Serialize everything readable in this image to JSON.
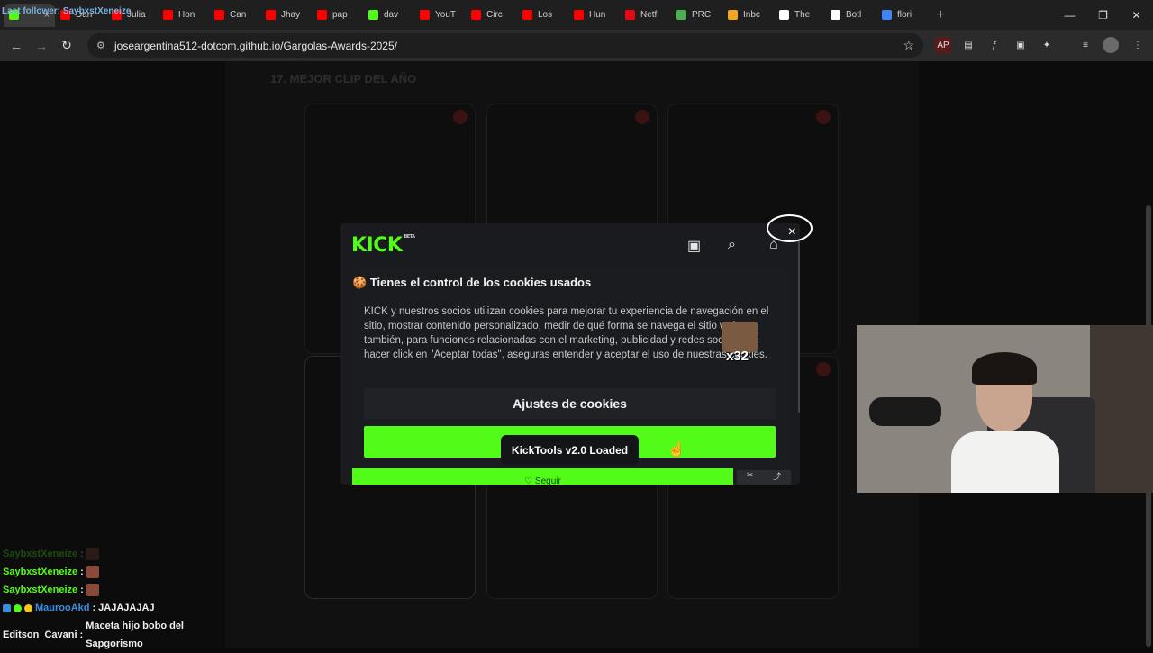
{
  "stream_overlay": {
    "follower_text": "Last follower: SaybxstXeneize"
  },
  "browser": {
    "tabs": [
      {
        "label": "",
        "favicon_color": "#53fc18",
        "active": true
      },
      {
        "label": "Dan",
        "favicon_color": "#ff0000"
      },
      {
        "label": "Julia",
        "favicon_color": "#ff0000"
      },
      {
        "label": "Hon",
        "favicon_color": "#ff0000"
      },
      {
        "label": "Can",
        "favicon_color": "#ff0000"
      },
      {
        "label": "Jhay",
        "favicon_color": "#ff0000"
      },
      {
        "label": "pap",
        "favicon_color": "#ff0000"
      },
      {
        "label": "dav",
        "favicon_color": "#53fc18"
      },
      {
        "label": "YouT",
        "favicon_color": "#ff0000"
      },
      {
        "label": "Circ",
        "favicon_color": "#ff0000"
      },
      {
        "label": "Los",
        "favicon_color": "#ff0000"
      },
      {
        "label": "Hun",
        "favicon_color": "#ff0000"
      },
      {
        "label": "Netf",
        "favicon_color": "#e50914"
      },
      {
        "label": "PRC",
        "favicon_color": "#4caf50"
      },
      {
        "label": "Inbc",
        "favicon_color": "#f5a623"
      },
      {
        "label": "The",
        "favicon_color": "#ffffff"
      },
      {
        "label": "Botl",
        "favicon_color": "#ffffff"
      },
      {
        "label": "flori",
        "favicon_color": "#4285f4"
      }
    ],
    "url": "joseargentina512-dotcom.github.io/Gargolas-Awards-2025/"
  },
  "page": {
    "section_title": "17. MEJOR CLIP DEL AÑO"
  },
  "kick_modal": {
    "logo": "KICK",
    "logo_badge": "BETA",
    "cookie_title": "Tienes el control de los cookies usados",
    "cookie_text": "KICK y nuestros socios utilizan cookies para mejorar tu experiencia de navegación en el sitio, mostrar contenido personalizado, medir de qué forma se navega el sitio web y, también, para funciones relacionadas con el marketing, publicidad y redes sociales. Al hacer click en \"Aceptar todas\", aseguras entender y aceptar el uso de nuestras cookies.",
    "settings_button": "Ajustes de cookies",
    "follow_button": "♡ Seguir",
    "close": "×"
  },
  "toast": {
    "text": "KickTools v2.0 Loaded"
  },
  "emote_overlay": {
    "multiplier": "x32"
  },
  "chat": {
    "messages": [
      {
        "user": "SaybxstXeneize",
        "text": "",
        "faded": true
      },
      {
        "user": "SaybxstXeneize",
        "text": ""
      },
      {
        "user": "SaybxstXeneize",
        "text": ""
      },
      {
        "user": "MaurooAkd",
        "text": "JAJAJAJAJ"
      },
      {
        "user": "Editson_Cavani",
        "text": "Maceta hijo bobo del Sapgorismo"
      }
    ]
  }
}
